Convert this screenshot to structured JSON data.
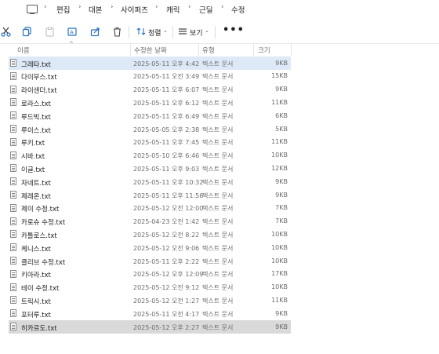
{
  "breadcrumb": {
    "items": [
      "편집",
      "대본",
      "사이퍼즈",
      "캐릭",
      "근딜",
      "수정"
    ]
  },
  "toolbar": {
    "sort_label": "정렬",
    "view_label": "보기",
    "more_label": "•••"
  },
  "columns": {
    "name": "이름",
    "date": "수정한 날짜",
    "type": "유형",
    "size": "크기"
  },
  "files": [
    {
      "name": "그레타.txt",
      "date": "2025-05-11 오후 4:42",
      "type": "텍스트 문서",
      "size": "9KB",
      "state": "hover"
    },
    {
      "name": "다이무스.txt",
      "date": "2025-05-11 오전 3:49",
      "type": "텍스트 문서",
      "size": "15KB",
      "state": ""
    },
    {
      "name": "라이샌더.txt",
      "date": "2025-05-11 오후 6:07",
      "type": "텍스트 문서",
      "size": "9KB",
      "state": ""
    },
    {
      "name": "로라스.txt",
      "date": "2025-05-11 오후 6:12",
      "type": "텍스트 문서",
      "size": "11KB",
      "state": ""
    },
    {
      "name": "루드빅.txt",
      "date": "2025-05-11 오후 6:49",
      "type": "텍스트 문서",
      "size": "6KB",
      "state": ""
    },
    {
      "name": "루이스.txt",
      "date": "2025-05-05 오후 2:38",
      "type": "텍스트 문서",
      "size": "5KB",
      "state": ""
    },
    {
      "name": "루키.txt",
      "date": "2025-05-11 오후 7:45",
      "type": "텍스트 문서",
      "size": "11KB",
      "state": ""
    },
    {
      "name": "시바.txt",
      "date": "2025-05-10 오후 6:46",
      "type": "텍스트 문서",
      "size": "10KB",
      "state": ""
    },
    {
      "name": "이글.txt",
      "date": "2025-05-11 오후 9:03",
      "type": "텍스트 문서",
      "size": "12KB",
      "state": ""
    },
    {
      "name": "자네트.txt",
      "date": "2025-05-11 오후 10:32",
      "type": "텍스트 문서",
      "size": "9KB",
      "state": ""
    },
    {
      "name": "제레온.txt",
      "date": "2025-05-11 오후 11:56",
      "type": "텍스트 문서",
      "size": "9KB",
      "state": ""
    },
    {
      "name": "제이 수정.txt",
      "date": "2025-05-12 오전 12:00",
      "type": "텍스트 문서",
      "size": "7KB",
      "state": ""
    },
    {
      "name": "카로슈 수정.txt",
      "date": "2025-04-23 오전 1:42",
      "type": "텍스트 문서",
      "size": "7KB",
      "state": ""
    },
    {
      "name": "카틀로스.txt",
      "date": "2025-05-12 오전 8:22",
      "type": "텍스트 문서",
      "size": "10KB",
      "state": ""
    },
    {
      "name": "케니스.txt",
      "date": "2025-05-12 오전 9:06",
      "type": "텍스트 문서",
      "size": "10KB",
      "state": ""
    },
    {
      "name": "클리브 수정.txt",
      "date": "2025-05-11 오후 2:22",
      "type": "텍스트 문서",
      "size": "10KB",
      "state": ""
    },
    {
      "name": "키아라.txt",
      "date": "2025-05-12 오후 12:09",
      "type": "텍스트 문서",
      "size": "17KB",
      "state": ""
    },
    {
      "name": "테이 수정.txt",
      "date": "2025-05-12 오전 9:12",
      "type": "텍스트 문서",
      "size": "10KB",
      "state": ""
    },
    {
      "name": "트릭시.txt",
      "date": "2025-05-12 오전 1:27",
      "type": "텍스트 문서",
      "size": "11KB",
      "state": ""
    },
    {
      "name": "포터루.txt",
      "date": "2025-05-11 오전 4:17",
      "type": "텍스트 문서",
      "size": "9KB",
      "state": ""
    },
    {
      "name": "히카르도.txt",
      "date": "2025-05-12 오후 2:27",
      "type": "텍스트 문서",
      "size": "9KB",
      "state": "selected"
    }
  ]
}
